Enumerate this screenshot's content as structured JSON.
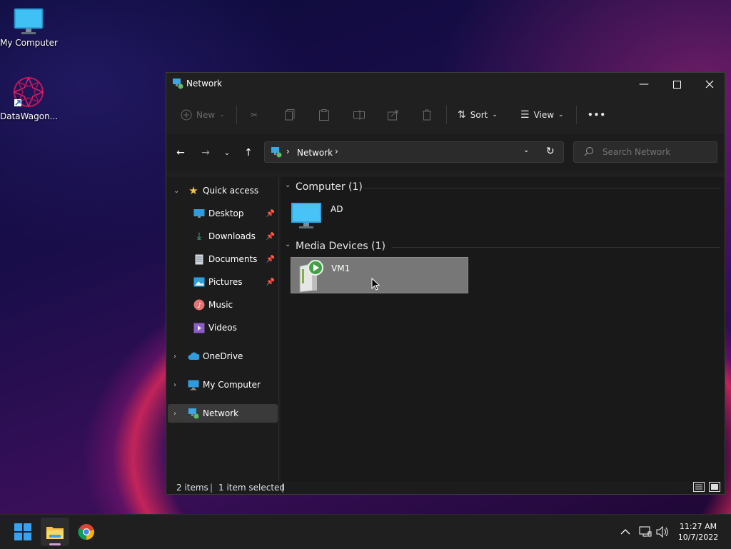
{
  "desktop": {
    "icons": [
      {
        "label": "My Computer"
      },
      {
        "label": "DataWagon..."
      }
    ]
  },
  "window": {
    "title": "Network",
    "toolbar": {
      "new_label": "New",
      "sort_label": "Sort",
      "view_label": "View",
      "more_label": "•••"
    },
    "address": {
      "crumb": "Network"
    },
    "search": {
      "placeholder": "Search Network"
    },
    "sidebar": {
      "quick_access": "Quick access",
      "items": [
        {
          "label": "Desktop"
        },
        {
          "label": "Downloads"
        },
        {
          "label": "Documents"
        },
        {
          "label": "Pictures"
        },
        {
          "label": "Music"
        },
        {
          "label": "Videos"
        }
      ],
      "onedrive": "OneDrive",
      "my_computer": "My Computer",
      "network": "Network"
    },
    "content": {
      "group1": {
        "header": "Computer (1)",
        "item": "AD"
      },
      "group2": {
        "header": "Media Devices (1)",
        "item": "VM1"
      }
    },
    "status": {
      "items": "2 items",
      "selected": "1 item selected"
    }
  },
  "taskbar": {
    "time": "11:27 AM",
    "date": "10/7/2022"
  },
  "colors": {
    "accent": "#0078d4",
    "window_bg": "#1f1f1f",
    "selection": "#777777"
  }
}
